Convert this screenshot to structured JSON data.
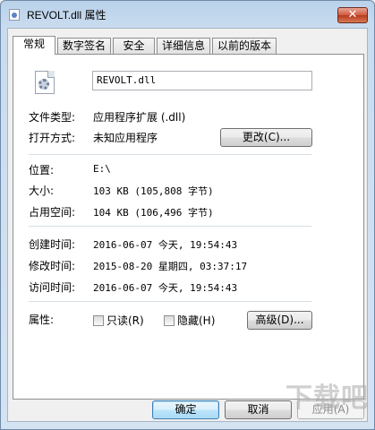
{
  "window": {
    "title": "REVOLT.dll 属性",
    "close_label": "✕"
  },
  "tabs": [
    {
      "label": "常规",
      "active": true
    },
    {
      "label": "数字签名"
    },
    {
      "label": "安全"
    },
    {
      "label": "详细信息"
    },
    {
      "label": "以前的版本"
    }
  ],
  "general": {
    "file_name": "REVOLT.dll",
    "file_icon": "dll-file-gear-icon",
    "file_type_label": "文件类型:",
    "file_type_value": "应用程序扩展 (.dll)",
    "open_with_label": "打开方式:",
    "open_with_value": "未知应用程序",
    "change_button": "更改(C)...",
    "location_label": "位置:",
    "location_value": "E:\\",
    "size_label": "大小:",
    "size_value": "103 KB (105,808 字节)",
    "size_on_disk_label": "占用空间:",
    "size_on_disk_value": "104 KB (106,496 字节)",
    "created_label": "创建时间:",
    "created_value": "2016-06-07 今天, 19:54:43",
    "modified_label": "修改时间:",
    "modified_value": "2015-08-20 星期四, 03:37:17",
    "accessed_label": "访问时间:",
    "accessed_value": "2016-06-07 今天, 19:54:43",
    "attributes_label": "属性:",
    "readonly_label": "只读(R)",
    "readonly_checked": false,
    "hidden_label": "隐藏(H)",
    "hidden_checked": false,
    "advanced_button": "高级(D)..."
  },
  "footer": {
    "ok": "确定",
    "cancel": "取消",
    "apply": "应用(A)"
  },
  "watermark": "下载吧"
}
